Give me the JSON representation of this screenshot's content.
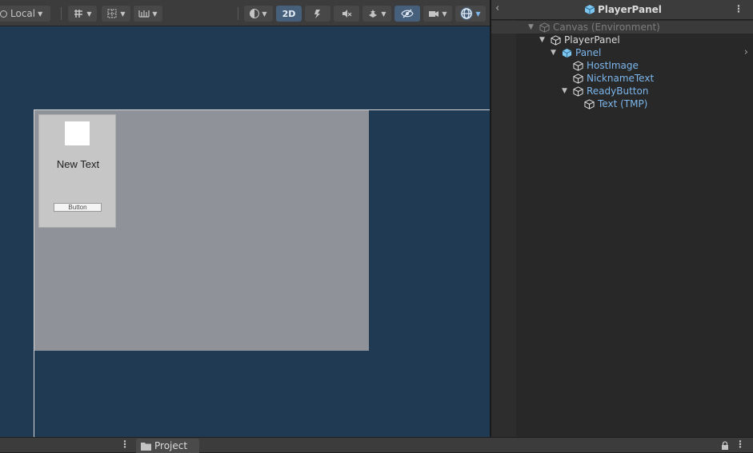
{
  "scene_toolbar": {
    "pivot_mode": "Local",
    "mode_2d": "2D"
  },
  "scene_view": {
    "card": {
      "text": "New Text",
      "button_label": "Button"
    }
  },
  "hierarchy": {
    "title": "PlayerPanel",
    "items": [
      {
        "label": "Canvas (Environment)"
      },
      {
        "label": "PlayerPanel"
      },
      {
        "label": "Panel"
      },
      {
        "label": "HostImage"
      },
      {
        "label": "NicknameText"
      },
      {
        "label": "ReadyButton"
      },
      {
        "label": "Text (TMP)"
      }
    ]
  },
  "footer": {
    "project_tab": "Project"
  },
  "colors": {
    "scene_bg": "#213a53",
    "panel_gray": "#8f9399",
    "prefab_blue": "#7cc6f0",
    "selected_link": "#5aa0e6",
    "active_2d": "#46607c"
  }
}
